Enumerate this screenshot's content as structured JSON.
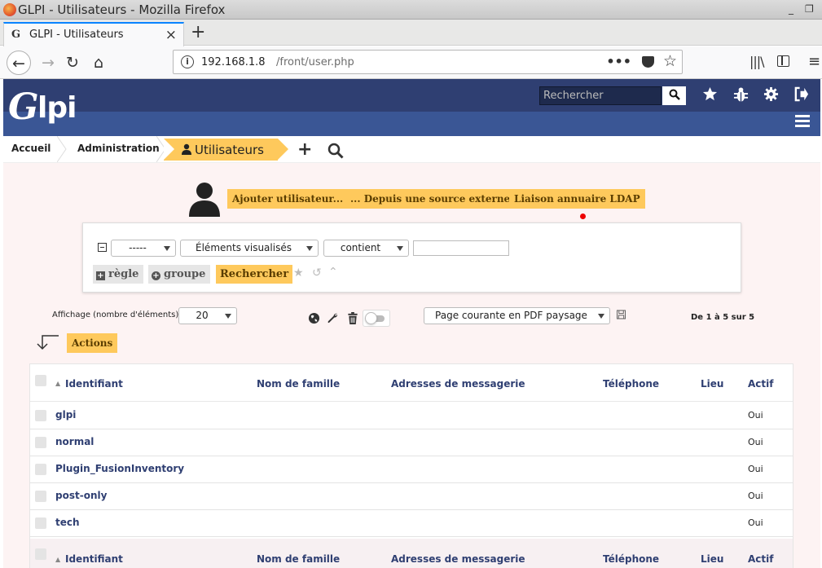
{
  "window": {
    "title": "GLPI - Utilisateurs - Mozilla Firefox",
    "min": "_",
    "max": "❐"
  },
  "browser": {
    "tab_title": "GLPI - Utilisateurs",
    "tab_favicon": "G",
    "tab_close": "×",
    "new_tab": "+",
    "url_host": "192.168.1.8",
    "url_path": "/front/user.php",
    "url_info": "i",
    "page_actions": "•••",
    "bookmark_star": "☆",
    "library": "|||\\"
  },
  "header": {
    "logo_g": "G",
    "logo_lpi": "lpi",
    "search_placeholder": "Rechercher",
    "icons": [
      "search-icon",
      "star-icon",
      "bug-icon",
      "gear-icon",
      "logout-icon",
      "hamburger-icon"
    ]
  },
  "breadcrumb": {
    "items": [
      "Accueil",
      "Administration"
    ],
    "active": "Utilisateurs",
    "add": "+",
    "search": "🔍"
  },
  "actions": {
    "add_user": "Ajouter utilisateur...",
    "from_external": "... Depuis une source externe",
    "ldap": "Liaison annuaire LDAP"
  },
  "search": {
    "field1": "-----",
    "field2": "Éléments visualisés",
    "field3": "contient",
    "input_value": "",
    "rule_btn": "règle",
    "group_btn": "groupe",
    "submit": "Rechercher"
  },
  "listing": {
    "display_label": "Affichage (nombre d'éléments)",
    "display_count": "20",
    "export_option": "Page courante en PDF paysage",
    "pager": "De 1 à 5 sur 5",
    "actions_btn": "Actions"
  },
  "table": {
    "columns": [
      "Identifiant",
      "Nom de famille",
      "Adresses de messagerie",
      "Téléphone",
      "Lieu",
      "Actif"
    ],
    "sort_indicator": "▲",
    "rows": [
      {
        "id": "glpi",
        "actif": "Oui"
      },
      {
        "id": "normal",
        "actif": "Oui"
      },
      {
        "id": "Plugin_FusionInventory",
        "actif": "Oui"
      },
      {
        "id": "post-only",
        "actif": "Oui"
      },
      {
        "id": "tech",
        "actif": "Oui"
      }
    ]
  },
  "colors": {
    "glpi_dark": "#2f3f72",
    "glpi_band": "#3a5695",
    "accent_yellow": "#fec95c"
  }
}
